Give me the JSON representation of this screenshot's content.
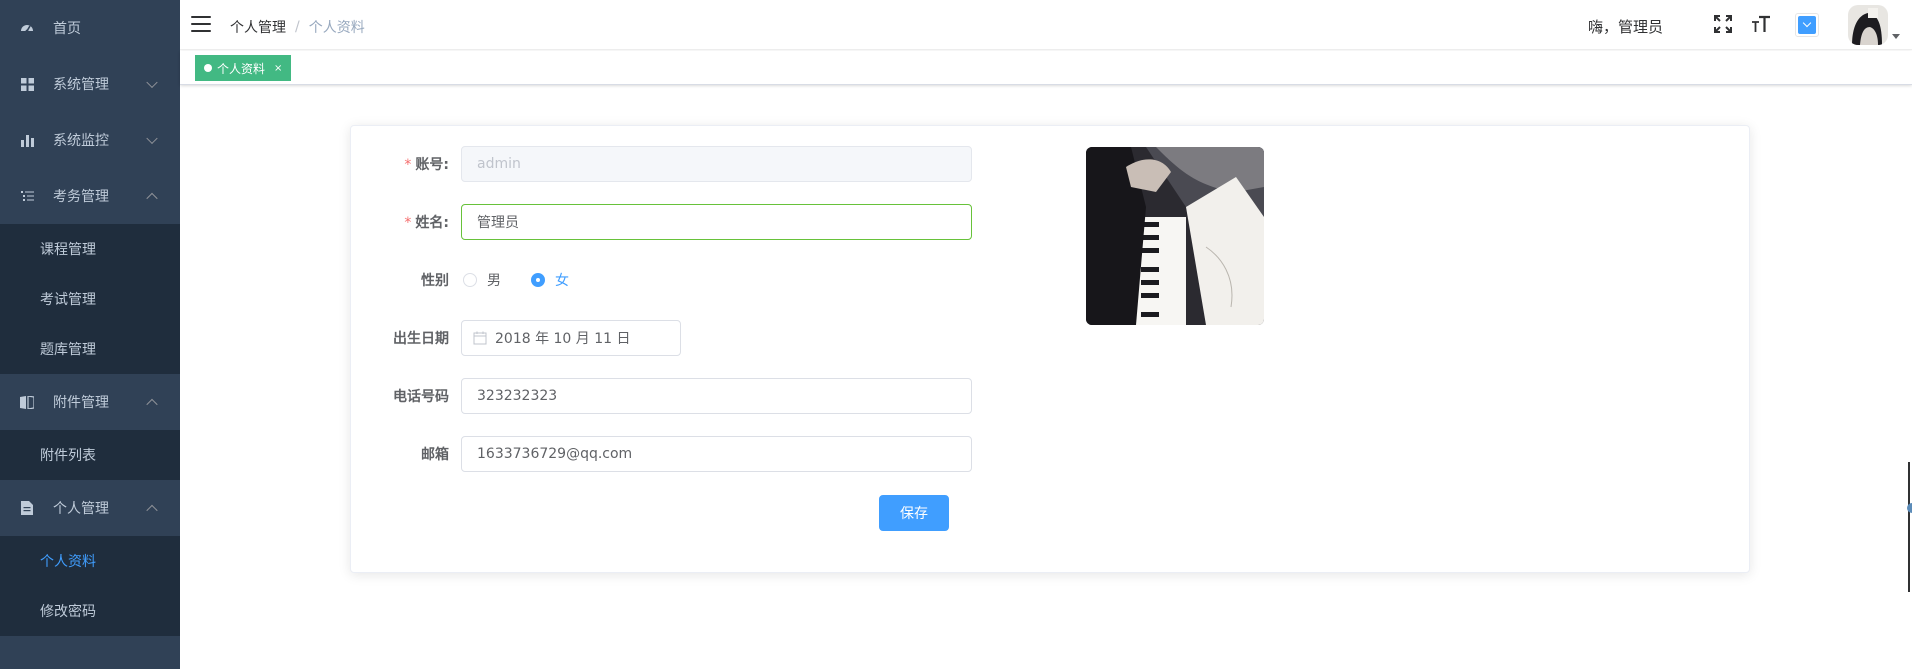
{
  "sidebar": {
    "items": [
      {
        "label": "首页",
        "icon": "dashboard-icon"
      },
      {
        "label": "系统管理",
        "icon": "grid-icon",
        "arrow": "down"
      },
      {
        "label": "系统监控",
        "icon": "bar-chart-icon",
        "arrow": "down"
      },
      {
        "label": "考务管理",
        "icon": "list-icon",
        "arrow": "up",
        "children": [
          "课程管理",
          "考试管理",
          "题库管理"
        ]
      },
      {
        "label": "附件管理",
        "icon": "book-icon",
        "arrow": "up",
        "children": [
          "附件列表"
        ]
      },
      {
        "label": "个人管理",
        "icon": "document-icon",
        "arrow": "up",
        "children": [
          "个人资料",
          "修改密码"
        ],
        "active_child": "个人资料"
      }
    ]
  },
  "navbar": {
    "breadcrumb": [
      "个人管理",
      "个人资料"
    ],
    "breadcrumb_separator": "/",
    "greeting": "嗨，管理员",
    "theme_color": "#409eff"
  },
  "tags": [
    {
      "label": "个人资料",
      "close": "×",
      "color": "#42b983"
    }
  ],
  "form": {
    "account_label": "账号:",
    "account_placeholder": "admin",
    "name_label": "姓名:",
    "name_value": "管理员",
    "gender_label": "性别",
    "gender_options": [
      "男",
      "女"
    ],
    "gender_selected": "女",
    "birthday_label": "出生日期",
    "birthday_value": "2018 年 10 月 11 日",
    "phone_label": "电话号码",
    "phone_value": "323232323",
    "email_label": "邮箱",
    "email_value": "1633736729@qq.com",
    "required_mark": "*",
    "save_label": "保存"
  },
  "colors": {
    "sidebar_bg": "#304156",
    "submenu_bg": "#1f2d3d",
    "primary": "#409eff",
    "tag_green": "#42b983",
    "required_red": "#f56c6c"
  }
}
